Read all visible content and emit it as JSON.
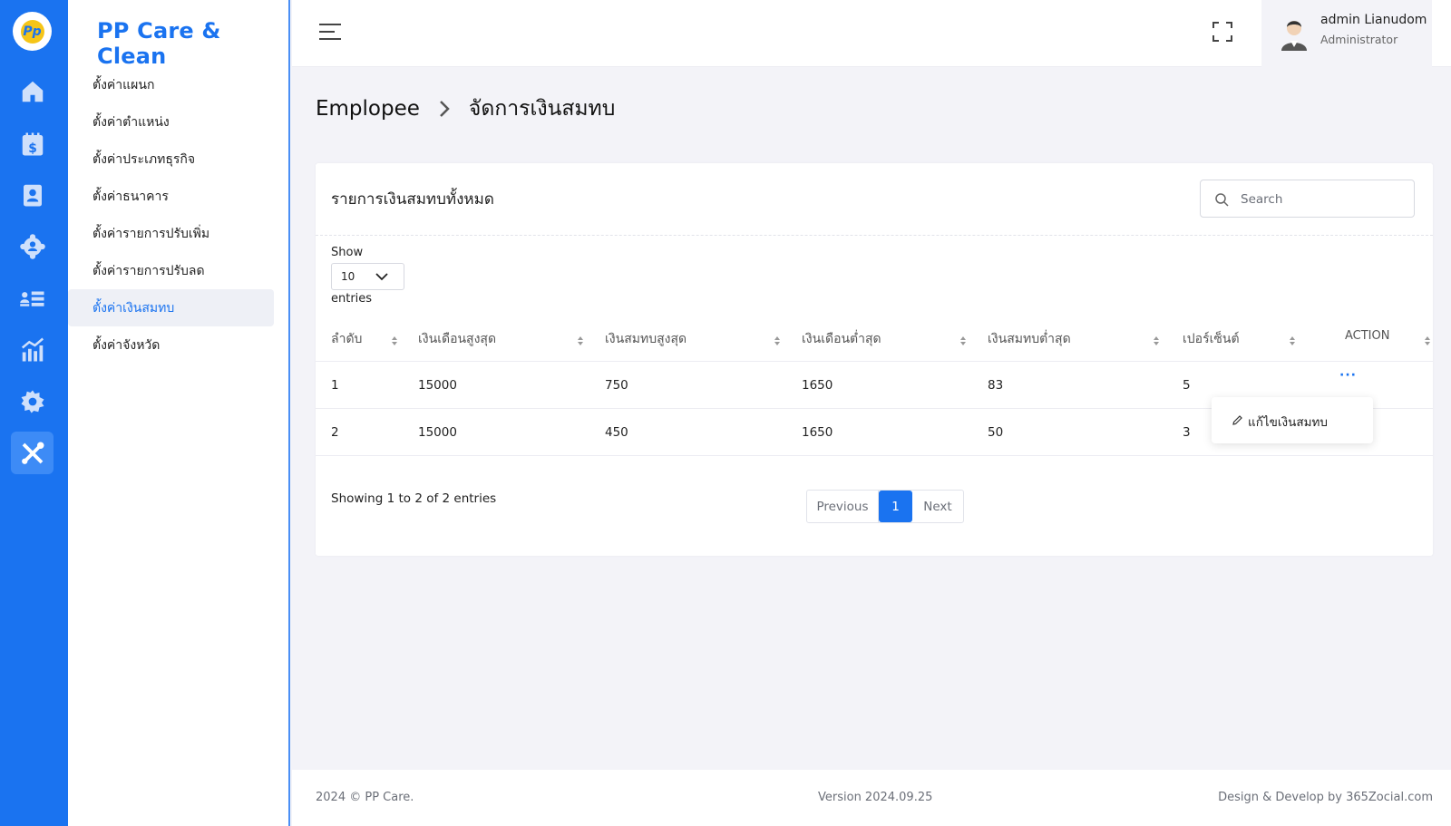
{
  "rail": {
    "logo_text": "Pp",
    "icons": [
      "home-icon",
      "payroll-calendar-icon",
      "employee-contact-icon",
      "team-icon",
      "list-icon",
      "report-chart-icon",
      "settings-gear-icon",
      "tools-icon"
    ]
  },
  "sidebar": {
    "brand": "PP Care & Clean",
    "items": [
      {
        "label": "ตั้งค่าแผนก"
      },
      {
        "label": "ตั้งค่าตำแหน่ง"
      },
      {
        "label": "ตั้งค่าประเภทธุรกิจ"
      },
      {
        "label": "ตั้งค่าธนาคาร"
      },
      {
        "label": "ตั้งค่ารายการปรับเพิ่ม"
      },
      {
        "label": "ตั้งค่ารายการปรับลด"
      },
      {
        "label": "ตั้งค่าเงินสมทบ"
      },
      {
        "label": "ตั้งค่าจังหวัด"
      }
    ],
    "active_index": 6
  },
  "topbar": {
    "user_name": "admin Lianudom",
    "user_role": "Administrator"
  },
  "breadcrumb": {
    "parent": "Emplopee",
    "current": "จัดการเงินสมทบ"
  },
  "card": {
    "title": "รายการเงินสมทบทั้งหมด",
    "search_placeholder": "Search",
    "show_label": "Show",
    "page_length": "10",
    "entries_label": "entries",
    "columns": [
      "ลำดับ",
      "เงินเดือนสูงสุด",
      "เงินสมทบสูงสุด",
      "เงินเดือนต่ำสุด",
      "เงินสมทบต่ำสุด",
      "เปอร์เซ็นต์",
      "ACTION"
    ],
    "rows": [
      [
        "1",
        "15000",
        "750",
        "1650",
        "83",
        "5"
      ],
      [
        "2",
        "15000",
        "450",
        "1650",
        "50",
        "3"
      ]
    ],
    "action_dots": "···",
    "info": "Showing 1 to 2 of 2 entries",
    "pager": {
      "previous": "Previous",
      "current": "1",
      "next": "Next"
    }
  },
  "dropdown": {
    "edit_label": "แก้ไขเงินสมทบ"
  },
  "footer": {
    "copyright": "2024 © PP Care.",
    "version": "Version 2024.09.25",
    "credit": "Design & Develop by 365Zocial.com"
  },
  "colors": {
    "primary": "#1a73f0",
    "rail_active": "#3d8bf6",
    "page_bg": "#f3f3f8"
  }
}
